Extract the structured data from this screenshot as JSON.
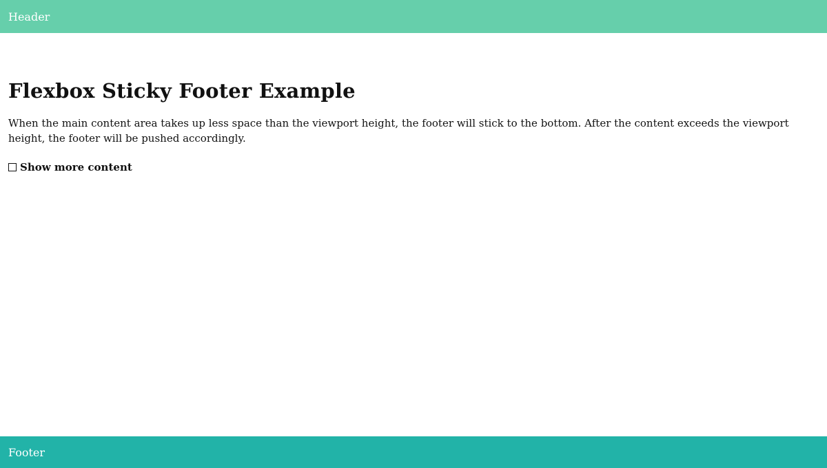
{
  "theme": {
    "header_bg": "#66cfab",
    "footer_bg": "#22b3a8",
    "text_color": "#111111"
  },
  "header": {
    "label": "Header"
  },
  "main": {
    "title": "Flexbox Sticky Footer Example",
    "paragraph": "When the main content area takes up less space than the viewport height, the footer will stick to the bottom. After the content exceeds the viewport height, the footer will be pushed accordingly.",
    "toggle": {
      "label": "Show more content",
      "checked": false
    }
  },
  "footer": {
    "label": "Footer"
  }
}
